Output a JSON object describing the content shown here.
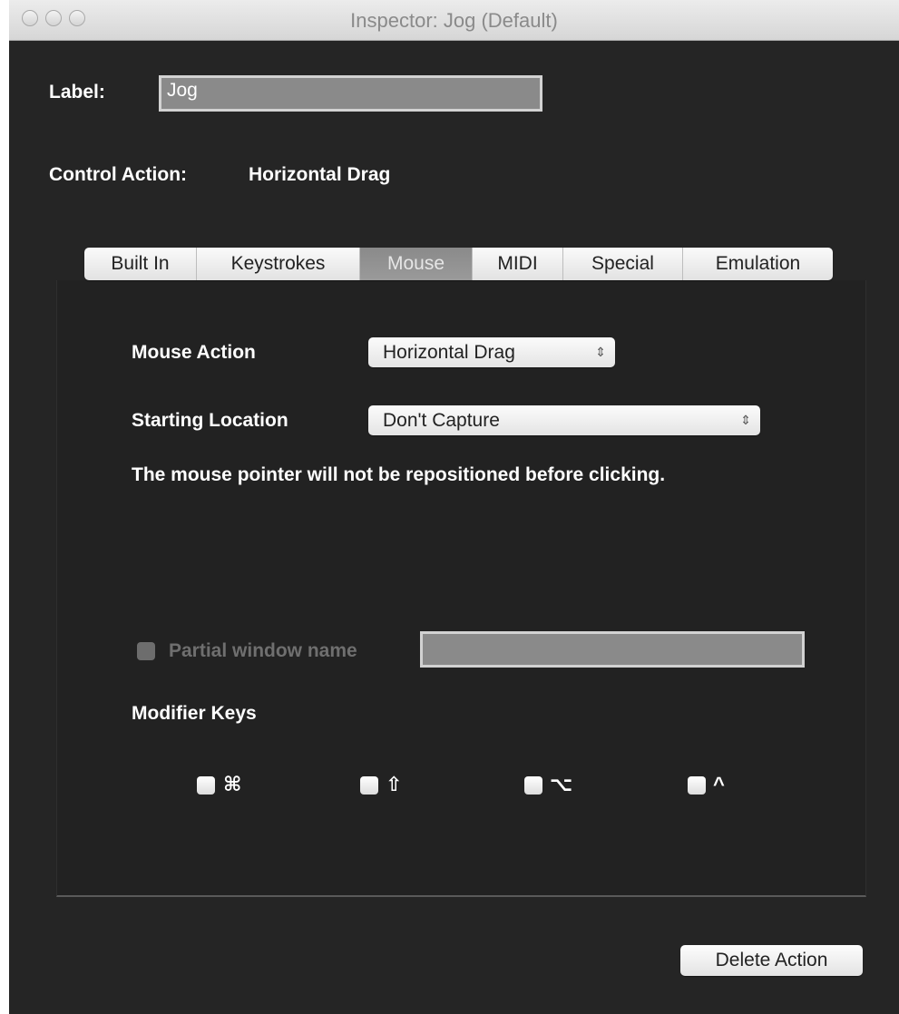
{
  "window": {
    "title": "Inspector: Jog (Default)"
  },
  "label": {
    "caption": "Label:",
    "value": "Jog"
  },
  "control_action": {
    "caption": "Control Action:",
    "value": "Horizontal Drag"
  },
  "tabs": [
    {
      "label": "Built In",
      "selected": false
    },
    {
      "label": "Keystrokes",
      "selected": false
    },
    {
      "label": "Mouse",
      "selected": true
    },
    {
      "label": "MIDI",
      "selected": false
    },
    {
      "label": "Special",
      "selected": false
    },
    {
      "label": "Emulation",
      "selected": false
    }
  ],
  "mouse": {
    "action_caption": "Mouse Action",
    "action_value": "Horizontal Drag",
    "location_caption": "Starting Location",
    "location_value": "Don't Capture",
    "description": "The mouse pointer will not be repositioned before clicking.",
    "partial_window_caption": "Partial window name",
    "partial_window_value": "",
    "partial_window_checked": false,
    "modifier_caption": "Modifier Keys",
    "modifiers": [
      {
        "symbol": "⌘",
        "icon": "command-icon",
        "checked": false
      },
      {
        "symbol": "⇧",
        "icon": "shift-icon",
        "checked": false
      },
      {
        "symbol": "⌥",
        "icon": "option-icon",
        "checked": false
      },
      {
        "symbol": "^",
        "icon": "control-icon",
        "checked": false
      }
    ]
  },
  "footer": {
    "delete_label": "Delete Action"
  },
  "icons": {
    "popup_arrows": "⇕"
  },
  "colors": {
    "background": "#252525",
    "selected_tab": "#8a8a8a",
    "text": "#ffffff"
  }
}
